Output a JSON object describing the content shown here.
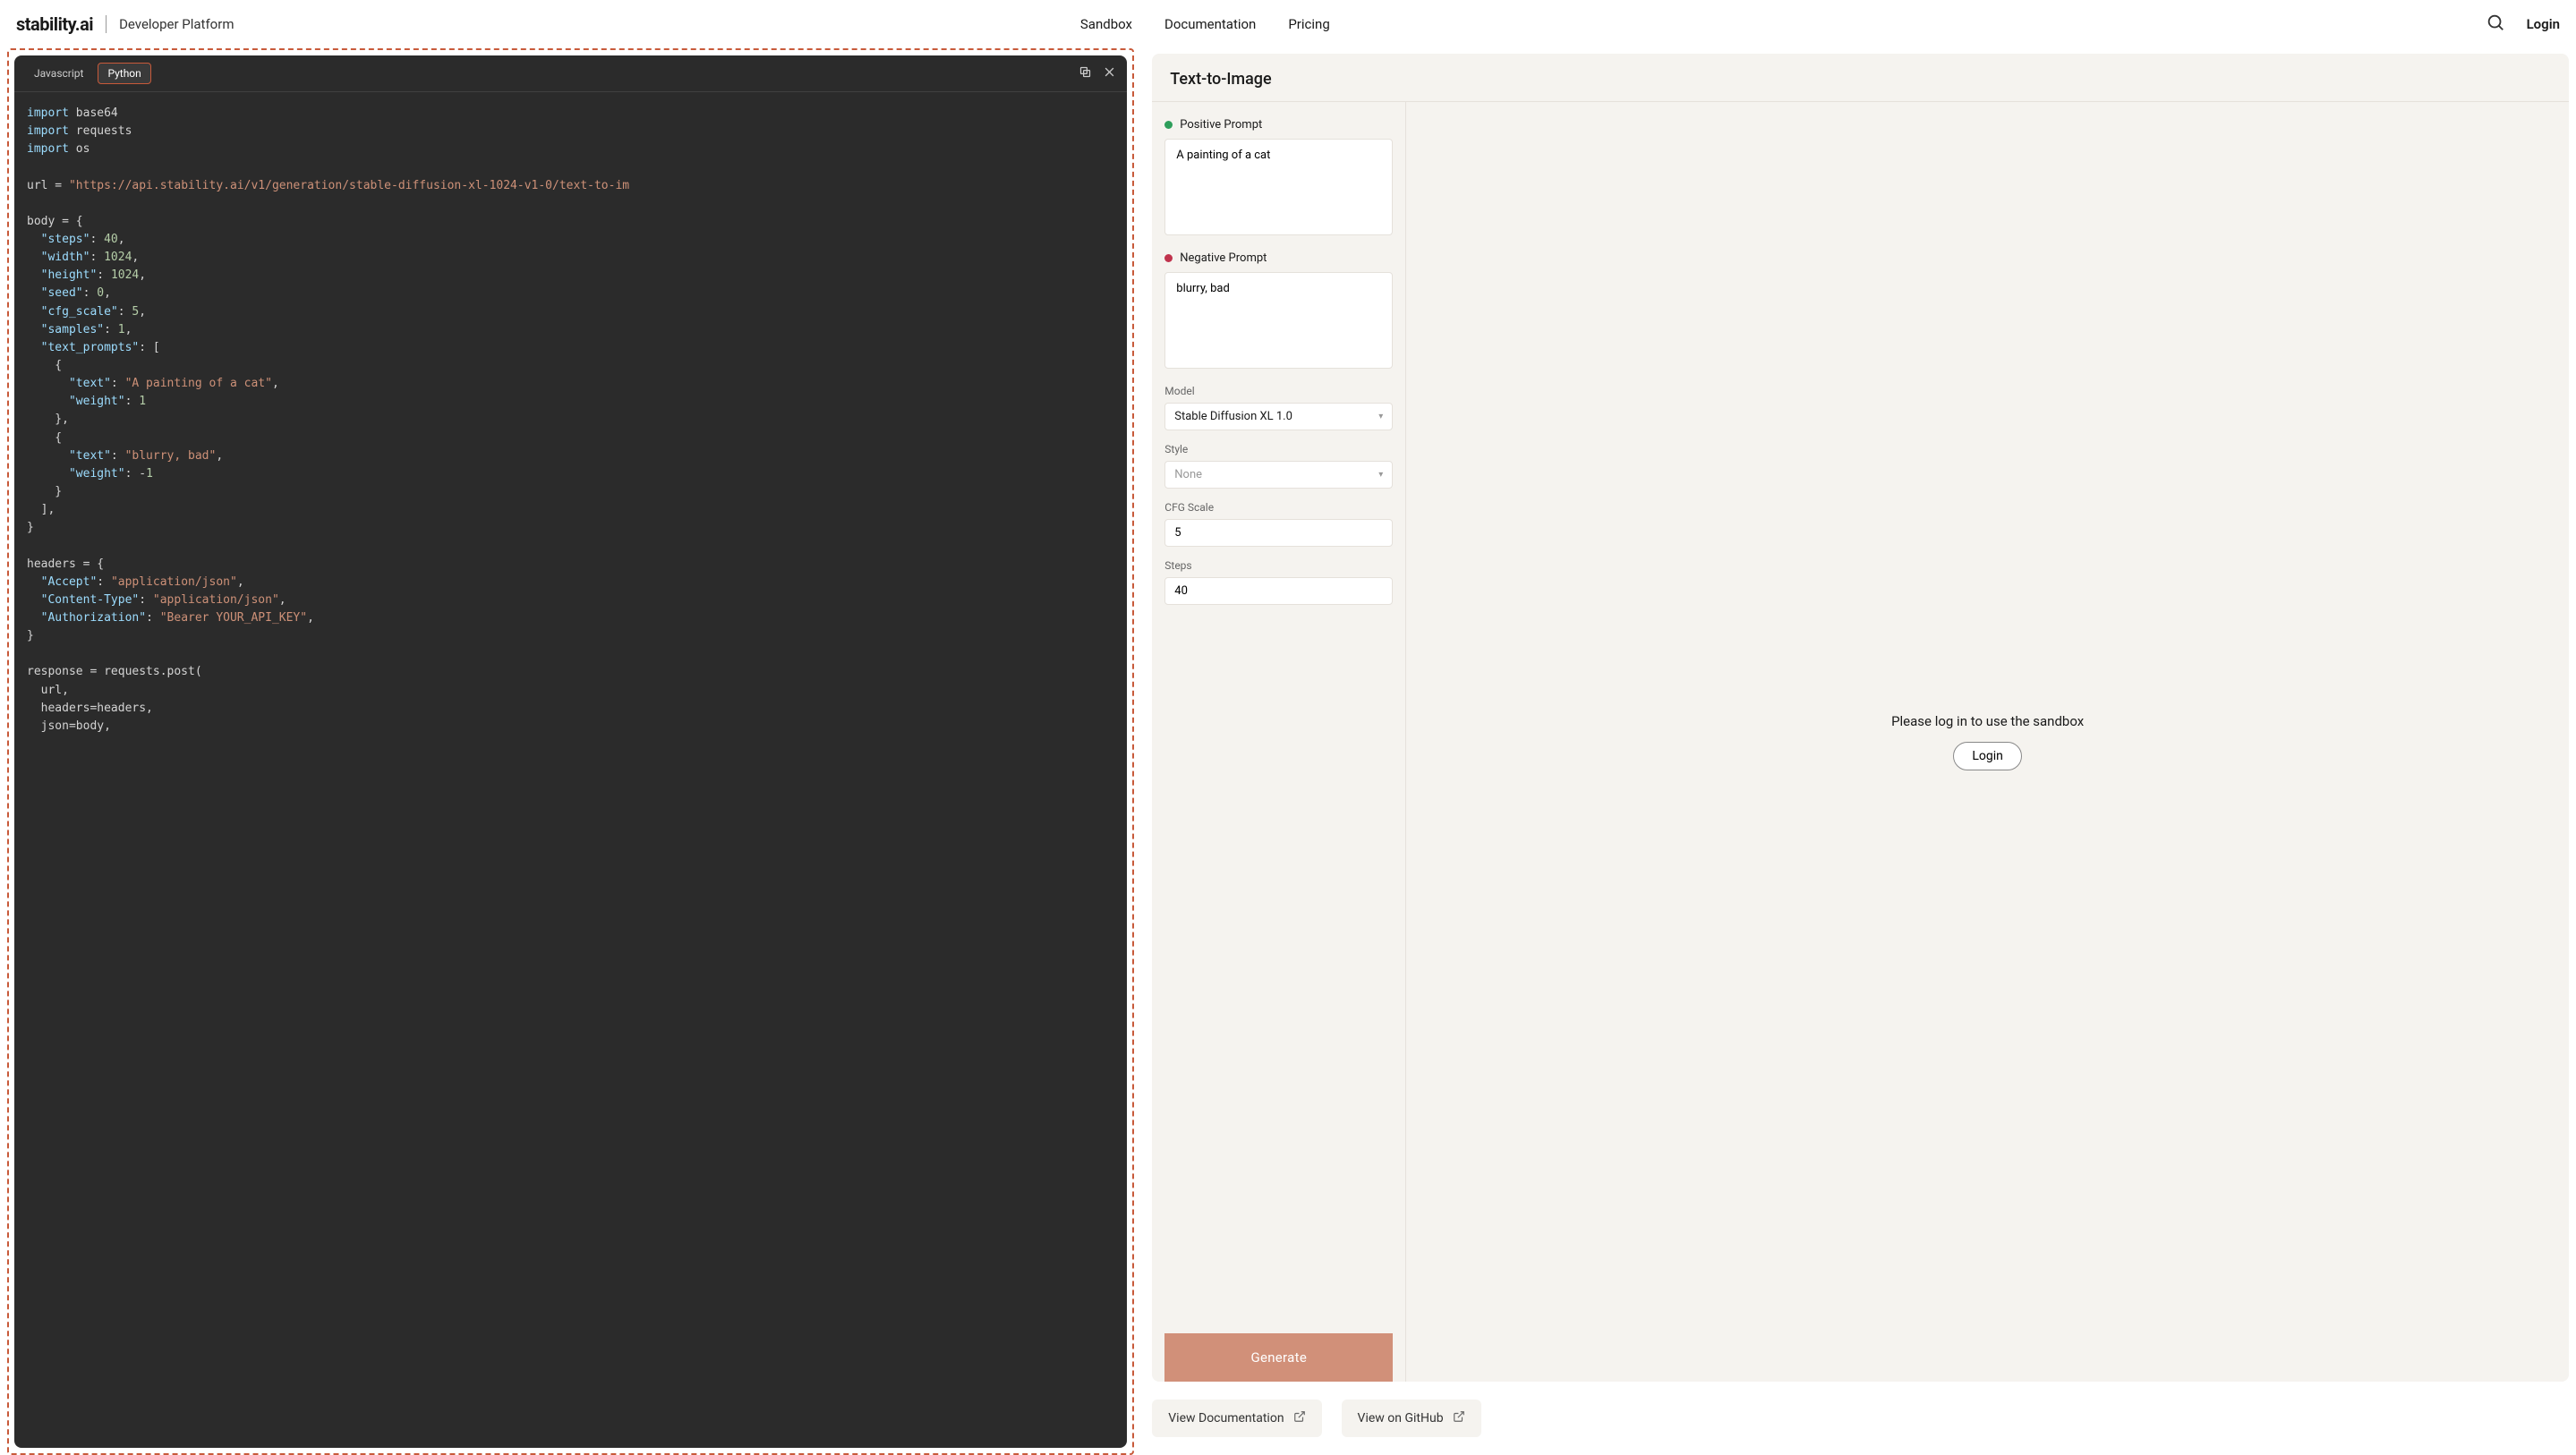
{
  "header": {
    "logo_text": "stability.ai",
    "platform_label": "Developer Platform",
    "nav": {
      "sandbox": "Sandbox",
      "documentation": "Documentation",
      "pricing": "Pricing"
    },
    "login": "Login"
  },
  "code": {
    "tabs": {
      "javascript": "Javascript",
      "python": "Python"
    },
    "lines": {
      "l1a": "import",
      "l1b": " base64",
      "l2a": "import",
      "l2b": " requests",
      "l3a": "import",
      "l3b": " os",
      "l5a": "url = ",
      "l5b": "\"https://api.stability.ai/v1/generation/stable-diffusion-xl-1024-v1-0/text-to-im",
      "l7": "body = {",
      "l8a": "  \"steps\"",
      "l8b": ": ",
      "l8c": "40",
      "l8d": ",",
      "l9a": "  \"width\"",
      "l9b": ": ",
      "l9c": "1024",
      "l9d": ",",
      "l10a": "  \"height\"",
      "l10b": ": ",
      "l10c": "1024",
      "l10d": ",",
      "l11a": "  \"seed\"",
      "l11b": ": ",
      "l11c": "0",
      "l11d": ",",
      "l12a": "  \"cfg_scale\"",
      "l12b": ": ",
      "l12c": "5",
      "l12d": ",",
      "l13a": "  \"samples\"",
      "l13b": ": ",
      "l13c": "1",
      "l13d": ",",
      "l14a": "  \"text_prompts\"",
      "l14b": ": [",
      "l15": "    {",
      "l16a": "      \"text\"",
      "l16b": ": ",
      "l16c": "\"A painting of a cat\"",
      "l16d": ",",
      "l17a": "      \"weight\"",
      "l17b": ": ",
      "l17c": "1",
      "l18": "    },",
      "l19": "    {",
      "l20a": "      \"text\"",
      "l20b": ": ",
      "l20c": "\"blurry, bad\"",
      "l20d": ",",
      "l21a": "      \"weight\"",
      "l21b": ": -",
      "l21c": "1",
      "l22": "    }",
      "l23": "  ],",
      "l24": "}",
      "l26": "headers = {",
      "l27a": "  \"Accept\"",
      "l27b": ": ",
      "l27c": "\"application/json\"",
      "l27d": ",",
      "l28a": "  \"Content-Type\"",
      "l28b": ": ",
      "l28c": "\"application/json\"",
      "l28d": ",",
      "l29a": "  \"Authorization\"",
      "l29b": ": ",
      "l29c": "\"Bearer YOUR_API_KEY\"",
      "l29d": ",",
      "l30": "}",
      "l32": "response = requests.post(",
      "l33": "  url,",
      "l34": "  headers=headers,",
      "l35": "  json=body,"
    }
  },
  "sandbox": {
    "title": "Text-to-Image",
    "positive_label": "Positive Prompt",
    "positive_value": "A painting of a cat",
    "negative_label": "Negative Prompt",
    "negative_value": "blurry, bad",
    "model_label": "Model",
    "model_value": "Stable Diffusion XL 1.0",
    "style_label": "Style",
    "style_value": "None",
    "cfg_label": "CFG Scale",
    "cfg_value": "5",
    "steps_label": "Steps",
    "steps_value": "40",
    "generate": "Generate",
    "preview_msg": "Please log in to use the sandbox",
    "login_btn": "Login"
  },
  "bottom": {
    "docs": "View Documentation",
    "github": "View on GitHub"
  }
}
